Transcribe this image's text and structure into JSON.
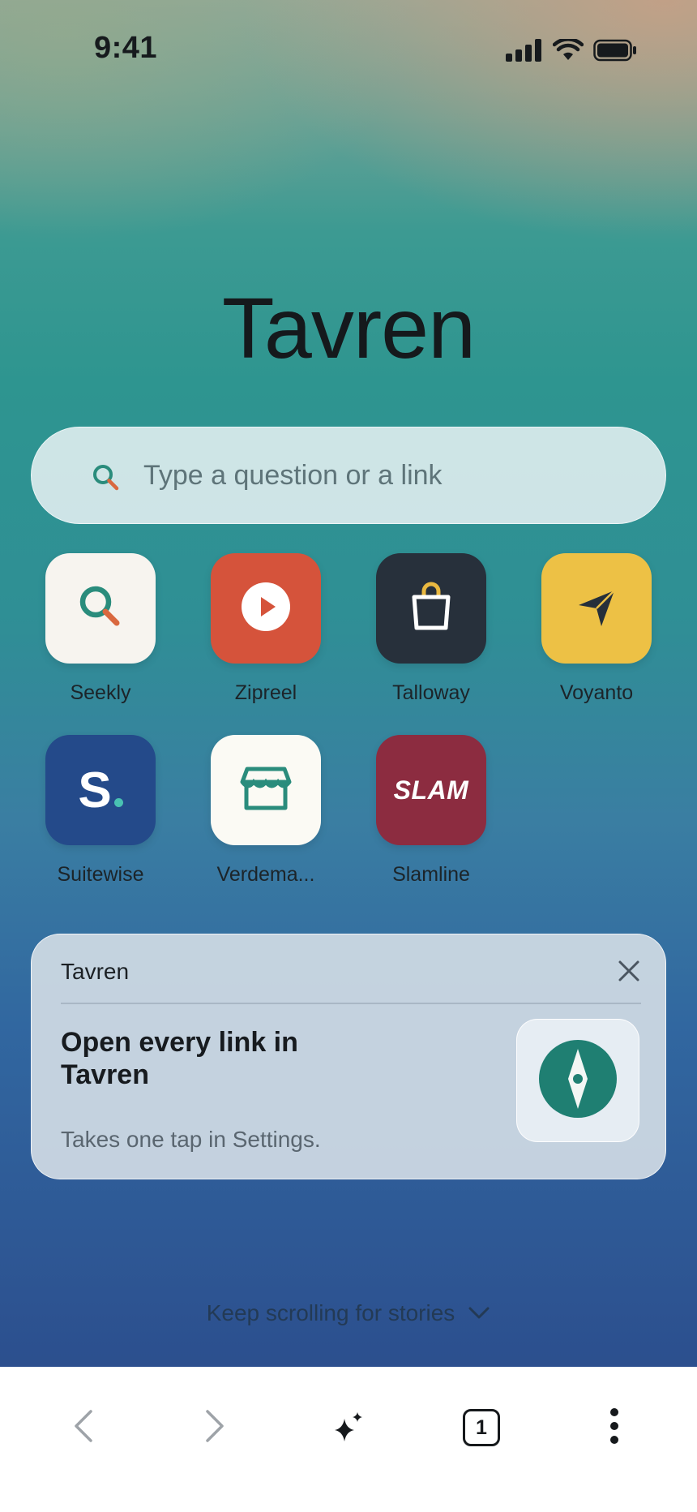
{
  "status_bar": {
    "time": "9:41",
    "icons": [
      "cellular-signal-icon",
      "wifi-icon",
      "battery-icon"
    ]
  },
  "brand": {
    "title": "Tavren"
  },
  "search": {
    "placeholder": "Type a question or a link",
    "value": ""
  },
  "shortcuts": [
    {
      "label": "Seekly",
      "icon": "magnifier-icon",
      "tile_color": "#f7f4ef"
    },
    {
      "label": "Zipreel",
      "icon": "play-icon",
      "tile_color": "#d5533b"
    },
    {
      "label": "Talloway",
      "icon": "shopping-bag-icon",
      "tile_color": "#27303b"
    },
    {
      "label": "Voyanto",
      "icon": "paper-plane-icon",
      "tile_color": "#edc145"
    },
    {
      "label": "Suitewise",
      "icon": "s-logo-icon",
      "logo_text": "S",
      "tile_color": "#244a8a"
    },
    {
      "label": "Verdema...",
      "icon": "storefront-icon",
      "tile_color": "#fbfaf4"
    },
    {
      "label": "Slamline",
      "icon": "slam-logo-icon",
      "logo_text": "SLAM",
      "tile_color": "#8c2c40"
    }
  ],
  "promo_card": {
    "brand": "Tavren",
    "headline": "Open every link in Tavren",
    "subtext": "Takes one tap in Settings.",
    "thumb_icon": "compass-icon",
    "close_icon": "close-icon"
  },
  "scroll_hint": {
    "text": "Keep scrolling for stories",
    "icon": "chevron-down-icon"
  },
  "toolbar": {
    "tab_count": "1",
    "icons": [
      "back-icon",
      "forward-icon",
      "sparkle-icon",
      "tabs-icon",
      "more-icon"
    ]
  },
  "colors": {
    "accent_teal": "#2a8c7c",
    "search_orange": "#d9683f",
    "text_dark": "#15191c"
  }
}
